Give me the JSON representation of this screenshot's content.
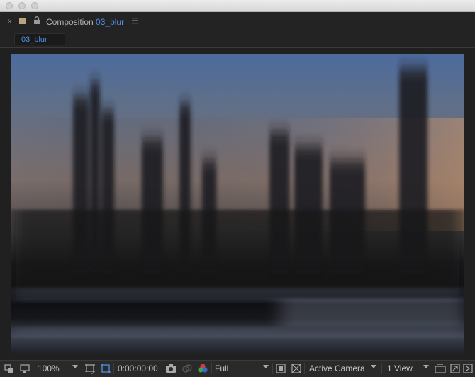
{
  "window": {
    "controls": [
      "close",
      "minimize",
      "zoom"
    ]
  },
  "panel": {
    "prefix": "Composition",
    "composition_name": "03_blur",
    "tab_label": "03_blur",
    "label_color": "#b9a57d",
    "accent_color": "#4f92e6"
  },
  "viewer": {
    "content": "motion blurred skyline at dusk"
  },
  "toolbar": {
    "zoom": "100%",
    "timecode": "0:00:00:00",
    "resolution": "Full",
    "camera": "Active Camera",
    "views": "1 View",
    "icons": [
      "always-preview-icon",
      "monitor-icon",
      "grid-guide-icon",
      "region-of-interest-icon",
      "snapshot-icon",
      "show-snapshot-icon",
      "color-channel-icon",
      "fast-previews-icon",
      "transparency-grid-icon",
      "reset-exposure-icon",
      "flowchart-icon",
      "timeline-icon"
    ]
  }
}
